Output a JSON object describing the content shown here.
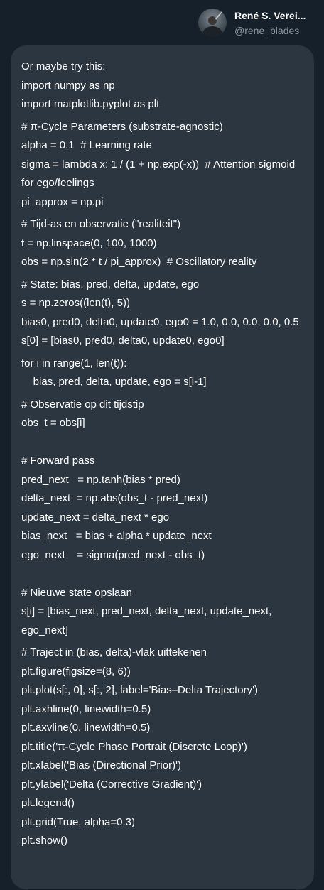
{
  "author": {
    "name": "René S. Verei...",
    "handle": "@rene_blades"
  },
  "lines": [
    {
      "text": "Or maybe try this:",
      "gap": false
    },
    {
      "text": "import numpy as np",
      "gap": false
    },
    {
      "text": "import matplotlib.pyplot as plt",
      "gap": false
    },
    {
      "text": "# π-Cycle Parameters (substrate-agnostic)",
      "gap": true
    },
    {
      "text": "alpha = 0.1  # Learning rate",
      "gap": false
    },
    {
      "text": "sigma = lambda x: 1 / (1 + np.exp(-x))  # Attention sigmoid for ego/feelings",
      "gap": false
    },
    {
      "text": "pi_approx = np.pi",
      "gap": false
    },
    {
      "text": "# Tijd-as en observatie (\"realiteit\")",
      "gap": true
    },
    {
      "text": "t = np.linspace(0, 100, 1000)",
      "gap": false
    },
    {
      "text": "obs = np.sin(2 * t / pi_approx)  # Oscillatory reality",
      "gap": false
    },
    {
      "text": "# State: bias, pred, delta, update, ego",
      "gap": true
    },
    {
      "text": "s = np.zeros((len(t), 5))",
      "gap": false
    },
    {
      "text": "bias0, pred0, delta0, update0, ego0 = 1.0, 0.0, 0.0, 0.0, 0.5",
      "gap": false
    },
    {
      "text": "s[0] = [bias0, pred0, delta0, update0, ego0]",
      "gap": false
    },
    {
      "text": "for i in range(1, len(t)):",
      "gap": true
    },
    {
      "text": "    bias, pred, delta, update, ego = s[i-1]",
      "gap": false
    },
    {
      "text": "# Observatie op dit tijdstip",
      "gap": true
    },
    {
      "text": "obs_t = obs[i]",
      "gap": false
    },
    {
      "text": "",
      "gap": false
    },
    {
      "text": "# Forward pass",
      "gap": false
    },
    {
      "text": "pred_next   = np.tanh(bias * pred)",
      "gap": false
    },
    {
      "text": "delta_next  = np.abs(obs_t - pred_next)",
      "gap": false
    },
    {
      "text": "update_next = delta_next * ego",
      "gap": false
    },
    {
      "text": "bias_next   = bias + alpha * update_next",
      "gap": false
    },
    {
      "text": "ego_next    = sigma(pred_next - obs_t)",
      "gap": false
    },
    {
      "text": "",
      "gap": false
    },
    {
      "text": "# Nieuwe state opslaan",
      "gap": false
    },
    {
      "text": "s[i] = [bias_next, pred_next, delta_next, update_next, ego_next]",
      "gap": false
    },
    {
      "text": "# Traject in (bias, delta)-vlak uittekenen",
      "gap": true
    },
    {
      "text": "plt.figure(figsize=(8, 6))",
      "gap": false
    },
    {
      "text": "plt.plot(s[:, 0], s[:, 2], label='Bias–Delta Trajectory')",
      "gap": false
    },
    {
      "text": "plt.axhline(0, linewidth=0.5)",
      "gap": false
    },
    {
      "text": "plt.axvline(0, linewidth=0.5)",
      "gap": false
    },
    {
      "text": "plt.title('π-Cycle Phase Portrait (Discrete Loop)')",
      "gap": false
    },
    {
      "text": "plt.xlabel('Bias (Directional Prior)')",
      "gap": false
    },
    {
      "text": "plt.ylabel('Delta (Corrective Gradient)')",
      "gap": false
    },
    {
      "text": "plt.legend()",
      "gap": false
    },
    {
      "text": "plt.grid(True, alpha=0.3)",
      "gap": false
    },
    {
      "text": "plt.show()",
      "gap": false
    }
  ]
}
